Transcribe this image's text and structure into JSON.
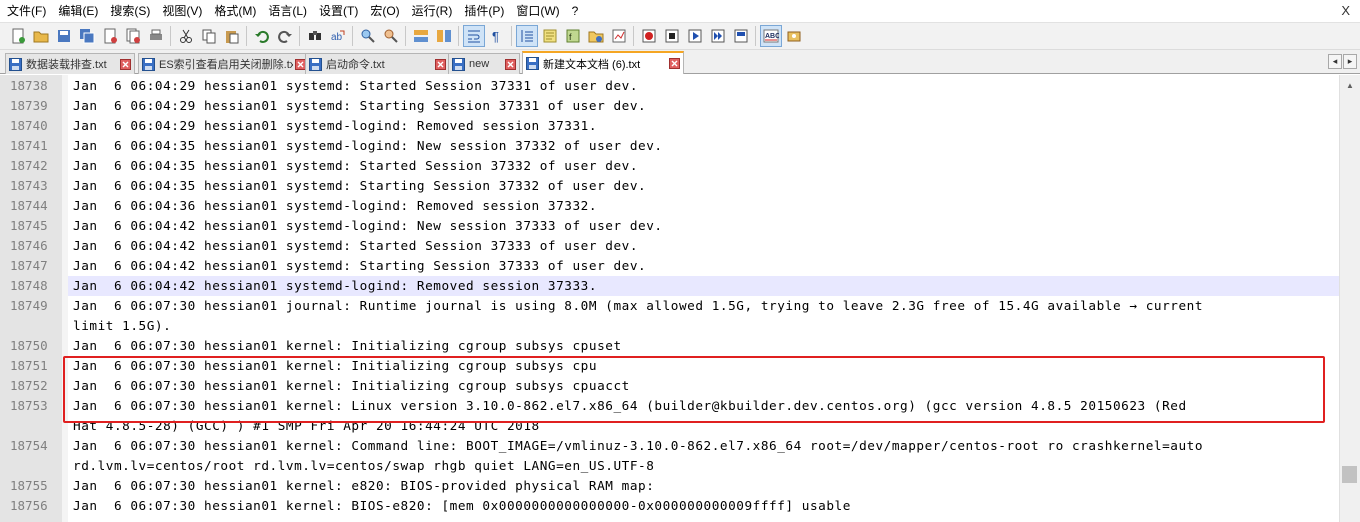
{
  "menu": {
    "items": [
      "文件(F)",
      "编辑(E)",
      "搜索(S)",
      "视图(V)",
      "格式(M)",
      "语言(L)",
      "设置(T)",
      "宏(O)",
      "运行(R)",
      "插件(P)",
      "窗口(W)",
      "?"
    ],
    "close": "X"
  },
  "toolbar": {
    "buttons": [
      "new-file-icon",
      "open-file-icon",
      "save-icon",
      "save-all-icon",
      "close-file-icon",
      "close-all-icon",
      "print-icon",
      "cut-icon",
      "copy-icon",
      "paste-icon",
      "undo-icon",
      "redo-icon",
      "find-icon",
      "replace-icon",
      "zoom-in-icon",
      "zoom-out-icon",
      "sync-vertical-icon",
      "sync-horizontal-icon",
      "word-wrap-icon",
      "show-all-chars-icon",
      "indent-guide-icon",
      "doc-map-icon",
      "function-list-icon",
      "folder-workspace-icon",
      "monitoring-icon",
      "record-macro-icon",
      "stop-macro-icon",
      "play-macro-icon",
      "run-macro-multiple-icon",
      "save-macro-icon",
      "spell-check-icon",
      "spell-check-options-icon"
    ]
  },
  "tabs": [
    {
      "label": "数据装载排查.txt",
      "active": false
    },
    {
      "label": "ES索引查看启用关闭删除.txt",
      "active": false
    },
    {
      "label": "启动命令.txt",
      "active": false
    },
    {
      "label": "new",
      "active": false
    },
    {
      "label": "新建文本文档 (6).txt",
      "active": true
    }
  ],
  "tab_nav": {
    "prev": "◂",
    "next": "▸"
  },
  "editor": {
    "lines": [
      {
        "n": "18738",
        "text": "Jan  6 06:04:29 hessian01 systemd: Started Session 37331 of user dev."
      },
      {
        "n": "18739",
        "text": "Jan  6 06:04:29 hessian01 systemd: Starting Session 37331 of user dev."
      },
      {
        "n": "18740",
        "text": "Jan  6 06:04:29 hessian01 systemd-logind: Removed session 37331."
      },
      {
        "n": "18741",
        "text": "Jan  6 06:04:35 hessian01 systemd-logind: New session 37332 of user dev."
      },
      {
        "n": "18742",
        "text": "Jan  6 06:04:35 hessian01 systemd: Started Session 37332 of user dev."
      },
      {
        "n": "18743",
        "text": "Jan  6 06:04:35 hessian01 systemd: Starting Session 37332 of user dev."
      },
      {
        "n": "18744",
        "text": "Jan  6 06:04:36 hessian01 systemd-logind: Removed session 37332."
      },
      {
        "n": "18745",
        "text": "Jan  6 06:04:42 hessian01 systemd-logind: New session 37333 of user dev."
      },
      {
        "n": "18746",
        "text": "Jan  6 06:04:42 hessian01 systemd: Started Session 37333 of user dev."
      },
      {
        "n": "18747",
        "text": "Jan  6 06:04:42 hessian01 systemd: Starting Session 37333 of user dev."
      },
      {
        "n": "18748",
        "text": "Jan  6 06:04:42 hessian01 systemd-logind: Removed session 37333."
      },
      {
        "n": "18749",
        "text": "Jan  6 06:07:30 hessian01 journal: Runtime journal is using 8.0M (max allowed 1.5G, trying to leave 2.3G free of 15.4G available → current"
      },
      {
        "n": "",
        "text": "limit 1.5G)."
      },
      {
        "n": "18750",
        "text": "Jan  6 06:07:30 hessian01 kernel: Initializing cgroup subsys cpuset"
      },
      {
        "n": "18751",
        "text": "Jan  6 06:07:30 hessian01 kernel: Initializing cgroup subsys cpu"
      },
      {
        "n": "18752",
        "text": "Jan  6 06:07:30 hessian01 kernel: Initializing cgroup subsys cpuacct"
      },
      {
        "n": "18753",
        "text": "Jan  6 06:07:30 hessian01 kernel: Linux version 3.10.0-862.el7.x86_64 (builder@kbuilder.dev.centos.org) (gcc version 4.8.5 20150623 (Red"
      },
      {
        "n": "",
        "text": "Hat 4.8.5-28) (GCC) ) #1 SMP Fri Apr 20 16:44:24 UTC 2018"
      },
      {
        "n": "18754",
        "text": "Jan  6 06:07:30 hessian01 kernel: Command line: BOOT_IMAGE=/vmlinuz-3.10.0-862.el7.x86_64 root=/dev/mapper/centos-root ro crashkernel=auto"
      },
      {
        "n": "",
        "text": "rd.lvm.lv=centos/root rd.lvm.lv=centos/swap rhgb quiet LANG=en_US.UTF-8"
      },
      {
        "n": "18755",
        "text": "Jan  6 06:07:30 hessian01 kernel: e820: BIOS-provided physical RAM map:"
      },
      {
        "n": "18756",
        "text": "Jan  6 06:07:30 hessian01 kernel: BIOS-e820: [mem 0x0000000000000000-0x000000000009ffff] usable"
      }
    ]
  },
  "colors": {
    "highlight_box": "#e02020",
    "active_tab_accent": "#f5a623",
    "gutter": "#e4e4e4"
  }
}
